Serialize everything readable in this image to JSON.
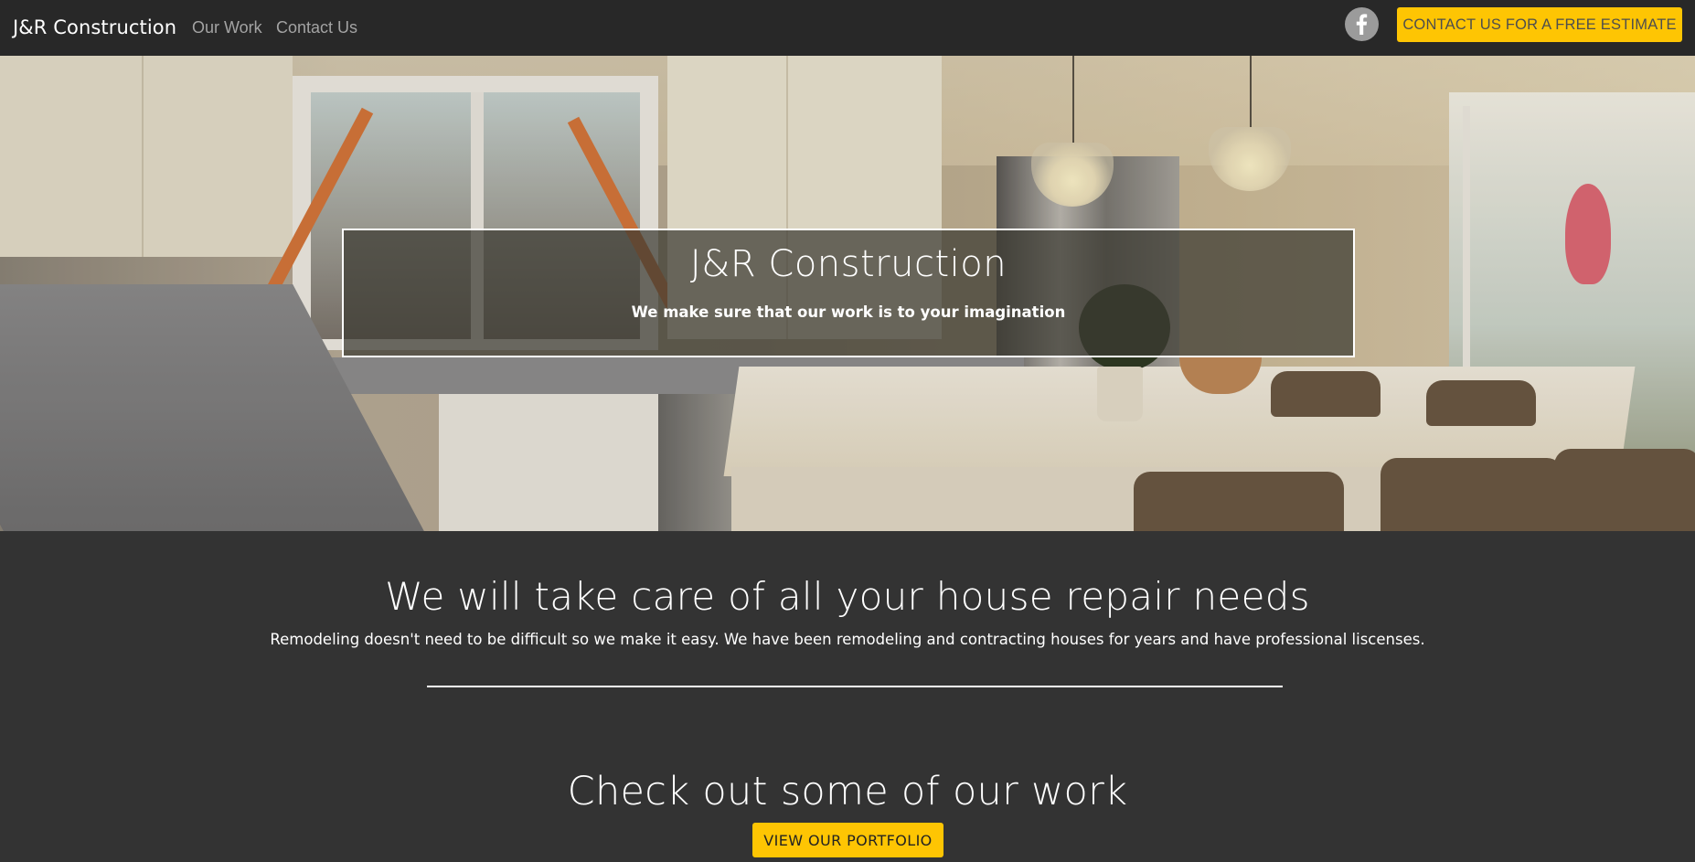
{
  "navbar": {
    "brand": "J&R Construction",
    "links": [
      {
        "label": "Our Work"
      },
      {
        "label": "Contact Us"
      }
    ],
    "social_icon": "facebook-icon",
    "cta_label": "CONTACT US FOR A FREE ESTIMATE"
  },
  "hero": {
    "background": "kitchen-photo",
    "title": "J&R Construction",
    "tagline": "We make sure that our work is to your imagination"
  },
  "intro": {
    "heading": "We will take care of all your house repair needs",
    "text": "Remodeling doesn't need to be difficult so we make it easy. We have been remodeling and contracting houses for years and have professional liscenses."
  },
  "work": {
    "heading": "Check out some of our work",
    "button_label": "VIEW OUR PORTFOLIO"
  },
  "colors": {
    "accent": "#fec503",
    "navbar_bg": "#282828",
    "page_bg": "#333333",
    "nav_link": "#a3a3a3"
  }
}
